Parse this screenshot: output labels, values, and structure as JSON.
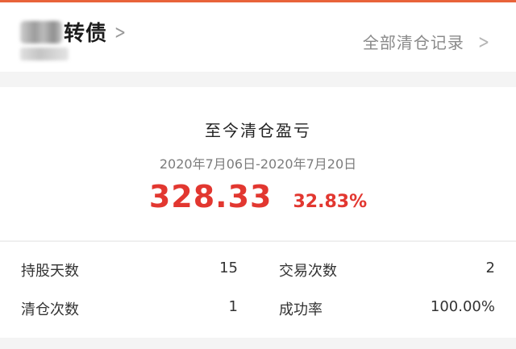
{
  "header": {
    "title": "转债",
    "all_records_label": "全部清仓记录"
  },
  "summary": {
    "title": "至今清仓盈亏",
    "date_range": "2020年7月06日-2020年7月20日",
    "pnl_amount": "328.33",
    "pnl_percent": "32.83%"
  },
  "stats": {
    "holding_days_label": "持股天数",
    "holding_days_value": "15",
    "trades_label": "交易次数",
    "trades_value": "2",
    "clearances_label": "清仓次数",
    "clearances_value": "1",
    "success_rate_label": "成功率",
    "success_rate_value": "100.00%"
  },
  "colors": {
    "accent": "#e8633a",
    "profit": "#e23730"
  }
}
